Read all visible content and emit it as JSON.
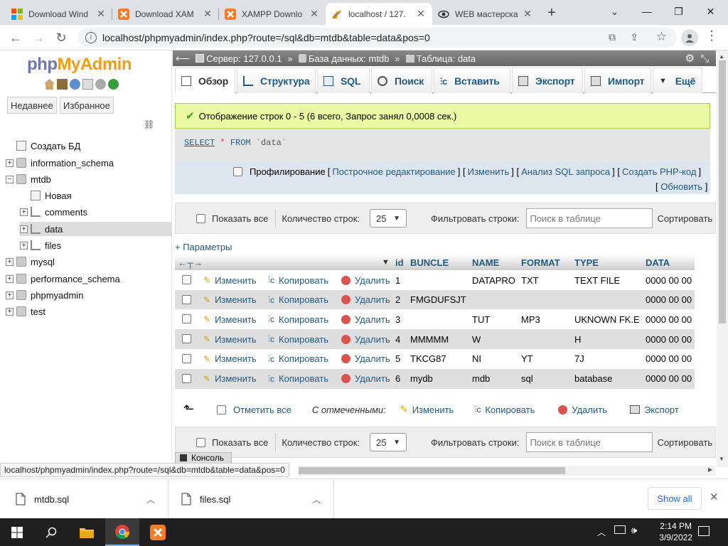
{
  "browser": {
    "tabs": [
      {
        "title": "Download Wind",
        "icon": "windows-icon"
      },
      {
        "title": "Download XAM",
        "icon": "xampp-icon"
      },
      {
        "title": "XAMPP Downlo",
        "icon": "xampp-icon"
      },
      {
        "title": "localhost / 127.",
        "icon": "phpmyadmin-icon",
        "active": true
      },
      {
        "title": "WEB мастерска",
        "icon": "eye-icon"
      }
    ],
    "url": "localhost/phpmyadmin/index.php?route=/sql&db=mtdb&table=data&pos=0"
  },
  "pma": {
    "logo_php": "php",
    "logo_my": "MyAdmin",
    "recent_label": "Недавнее",
    "favorites_label": "Избранное",
    "tree": [
      {
        "label": "Создать БД",
        "level": 0,
        "expander": "",
        "icon": "new-db-icon"
      },
      {
        "label": "information_schema",
        "level": 0,
        "expander": "+",
        "icon": "database-icon"
      },
      {
        "label": "mtdb",
        "level": 0,
        "expander": "−",
        "icon": "database-icon"
      },
      {
        "label": "Новая",
        "level": 1,
        "expander": "",
        "icon": "new-table-icon"
      },
      {
        "label": "comments",
        "level": 1,
        "expander": "+",
        "icon": "table-icon"
      },
      {
        "label": "data",
        "level": 1,
        "expander": "+",
        "icon": "table-icon",
        "selected": true
      },
      {
        "label": "files",
        "level": 1,
        "expander": "+",
        "icon": "table-icon"
      },
      {
        "label": "mysql",
        "level": 0,
        "expander": "+",
        "icon": "database-icon"
      },
      {
        "label": "performance_schema",
        "level": 0,
        "expander": "+",
        "icon": "database-icon"
      },
      {
        "label": "phpmyadmin",
        "level": 0,
        "expander": "+",
        "icon": "database-icon"
      },
      {
        "label": "test",
        "level": 0,
        "expander": "+",
        "icon": "database-icon"
      }
    ],
    "breadcrumb": {
      "server": "Сервер: 127.0.0.1",
      "database": "База данных: mtdb",
      "table": "Таблица: data"
    },
    "tabs": [
      {
        "label": "Обзор",
        "active": true
      },
      {
        "label": "Структура"
      },
      {
        "label": "SQL"
      },
      {
        "label": "Поиск"
      },
      {
        "label": "Вставить"
      },
      {
        "label": "Экспорт"
      },
      {
        "label": "Импорт"
      },
      {
        "label": "Ещё"
      }
    ],
    "success_message": "Отображение строк 0 - 5 (6 всего, Запрос занял 0,0008 сек.)",
    "sql": {
      "select": "SELECT",
      "star": "*",
      "from": "FROM",
      "table": "`data`"
    },
    "sql_options": {
      "profiling": "Профилирование",
      "inline_edit": "Построчное редактирование",
      "edit": "Изменить",
      "analyze": "Анализ SQL запроса",
      "php_code": "Создать PHP-код",
      "refresh": "Обновить"
    },
    "filter_bar": {
      "show_all": "Показать все",
      "row_count_label": "Количество строк:",
      "row_count_value": "25",
      "filter_label": "Фильтровать строки:",
      "search_placeholder": "Поиск в таблице",
      "sort_label": "Сортировать"
    },
    "params_link": "+ Параметры",
    "columns": [
      "id",
      "BUNCLE",
      "NAME",
      "FORMAT",
      "TYPE",
      "DATA"
    ],
    "actions": {
      "edit": "Изменить",
      "copy": "Копировать",
      "delete": "Удалить"
    },
    "rows": [
      {
        "id": "1",
        "BUNCLE": "",
        "NAME": "DATAPRO",
        "FORMAT": "TXT",
        "TYPE": "TEXT FILE",
        "DATA": "0000 00 00"
      },
      {
        "id": "2",
        "BUNCLE": "FMGDUFSJT",
        "NAME": "",
        "FORMAT": "",
        "TYPE": "",
        "DATA": "0000 00 00"
      },
      {
        "id": "3",
        "BUNCLE": "",
        "NAME": "TUT",
        "FORMAT": "MP3",
        "TYPE": "UKNOWN FK.E",
        "DATA": "0000 00 00"
      },
      {
        "id": "4",
        "BUNCLE": "MMMMM",
        "NAME": "W",
        "FORMAT": "",
        "TYPE": "H",
        "DATA": "0000 00 00"
      },
      {
        "id": "5",
        "BUNCLE": "TKCG87",
        "NAME": "NI",
        "FORMAT": "YT",
        "TYPE": "7J",
        "DATA": "0000 00 00"
      },
      {
        "id": "6",
        "BUNCLE": "mydb",
        "NAME": "mdb",
        "FORMAT": "sql",
        "TYPE": "batabase",
        "DATA": "0000 00 00"
      }
    ],
    "bulk": {
      "check_all": "Отметить все",
      "with_selected": "С отмеченными:",
      "edit": "Изменить",
      "copy": "Копировать",
      "delete": "Удалить",
      "export": "Экспорт"
    },
    "console_label": "Консоль"
  },
  "status_url": "localhost/phpmyadmin/index.php?route=/sql&db=mtdb&table=data&pos=0",
  "downloads": {
    "items": [
      "mtdb.sql",
      "files.sql"
    ],
    "show_all": "Show all"
  },
  "taskbar": {
    "time": "2:14 PM",
    "date": "3/9/2022"
  },
  "colors": {
    "pma_link": "#235a81",
    "success_bg": "#ebf8a4",
    "delete_red": "#d9534f"
  }
}
